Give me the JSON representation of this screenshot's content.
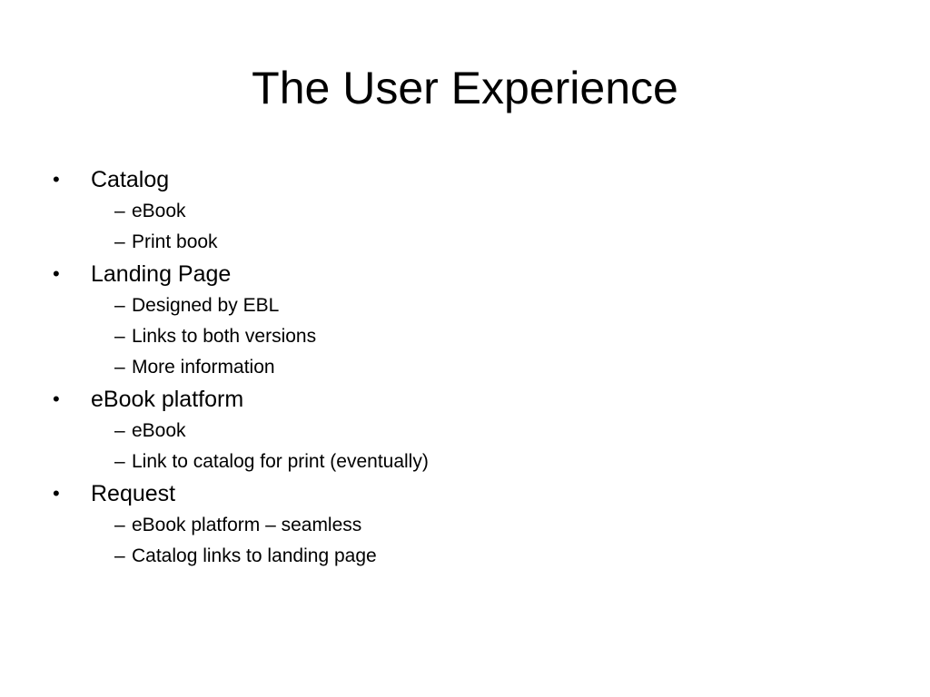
{
  "slide": {
    "title": "The User Experience",
    "bullet_glyph": "•",
    "sub_bullet_glyph": "–",
    "items": [
      {
        "label": "Catalog",
        "children": [
          "eBook",
          "Print book"
        ]
      },
      {
        "label": "Landing Page",
        "children": [
          "Designed by EBL",
          "Links to both versions",
          "More information"
        ]
      },
      {
        "label": "eBook platform",
        "children": [
          "eBook",
          "Link to catalog for print (eventually)"
        ]
      },
      {
        "label": "Request",
        "children": [
          "eBook platform – seamless",
          "Catalog links to landing page"
        ]
      }
    ]
  }
}
